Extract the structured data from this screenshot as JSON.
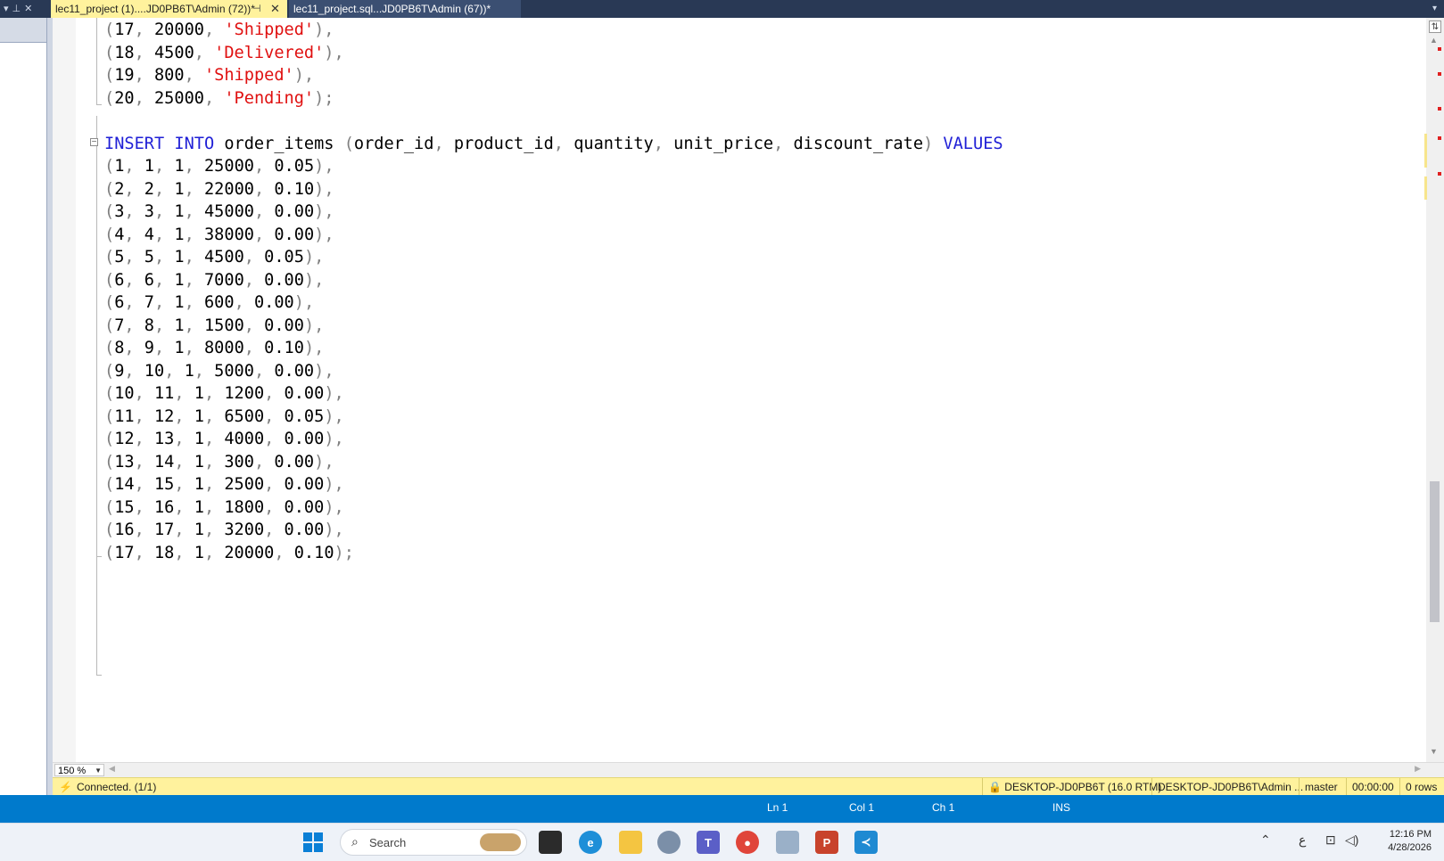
{
  "tabs": [
    {
      "label": "lec11_project (1)....JD0PB6T\\Admin (72))*",
      "active": true
    },
    {
      "label": "lec11_project.sql...JD0PB6T\\Admin (67))*",
      "active": false
    }
  ],
  "editor": {
    "prev_rows": [
      {
        "open": "(",
        "a": "17",
        "b": "20000",
        "status": "'Shipped'",
        "close": "),"
      },
      {
        "open": "(",
        "a": "18",
        "b": "4500",
        "status": "'Delivered'",
        "close": "),"
      },
      {
        "open": "(",
        "a": "19",
        "b": "800",
        "status": "'Shipped'",
        "close": "),"
      },
      {
        "open": "(",
        "a": "20",
        "b": "25000",
        "status": "'Pending'",
        "close": ");"
      }
    ],
    "insert": {
      "kw1": "INSERT",
      "kw2": "INTO",
      "table": "order_items",
      "columns": [
        "order_id",
        "product_id",
        "quantity",
        "unit_price",
        "discount_rate"
      ],
      "kw3": "VALUES"
    },
    "value_rows": [
      [
        "1",
        "1",
        "1",
        "25000",
        "0.05"
      ],
      [
        "2",
        "2",
        "1",
        "22000",
        "0.10"
      ],
      [
        "3",
        "3",
        "1",
        "45000",
        "0.00"
      ],
      [
        "4",
        "4",
        "1",
        "38000",
        "0.00"
      ],
      [
        "5",
        "5",
        "1",
        "4500",
        "0.05"
      ],
      [
        "6",
        "6",
        "1",
        "7000",
        "0.00"
      ],
      [
        "6",
        "7",
        "1",
        "600",
        "0.00"
      ],
      [
        "7",
        "8",
        "1",
        "1500",
        "0.00"
      ],
      [
        "8",
        "9",
        "1",
        "8000",
        "0.10"
      ],
      [
        "9",
        "10",
        "1",
        "5000",
        "0.00"
      ],
      [
        "10",
        "11",
        "1",
        "1200",
        "0.00"
      ],
      [
        "11",
        "12",
        "1",
        "6500",
        "0.05"
      ],
      [
        "12",
        "13",
        "1",
        "4000",
        "0.00"
      ],
      [
        "13",
        "14",
        "1",
        "300",
        "0.00"
      ],
      [
        "14",
        "15",
        "1",
        "2500",
        "0.00"
      ],
      [
        "15",
        "16",
        "1",
        "1800",
        "0.00"
      ],
      [
        "16",
        "17",
        "1",
        "3200",
        "0.00"
      ],
      [
        "17",
        "18",
        "1",
        "20000",
        "0.10"
      ]
    ]
  },
  "zoom": "150 %",
  "query_status": {
    "connected": "Connected. (1/1)",
    "server": "DESKTOP-JD0PB6T (16.0 RTM)",
    "user": "DESKTOP-JD0PB6T\\Admin ...",
    "database": "master",
    "elapsed": "00:00:00",
    "rows": "0 rows"
  },
  "status_bar": {
    "ln": "Ln 1",
    "col": "Col 1",
    "ch": "Ch 1",
    "mode": "INS"
  },
  "taskbar": {
    "search_placeholder": "Search",
    "tray_lang": "ع",
    "time": "12:16 PM",
    "date": "4/28/2026"
  },
  "colors": {
    "keyword": "#1f1fd6",
    "string": "#e01010",
    "punct": "#808080",
    "tab_active": "#fff29d",
    "status_blue": "#007acc"
  },
  "icons": [
    "windows-start-icon",
    "search-icon",
    "task-view-icon",
    "edge-icon",
    "file-explorer-icon",
    "teams-icon",
    "chrome-icon",
    "powerpoint-icon",
    "vscode-icon",
    "chevron-up-icon",
    "network-icon",
    "volume-icon",
    "lock-icon",
    "plug-icon"
  ]
}
